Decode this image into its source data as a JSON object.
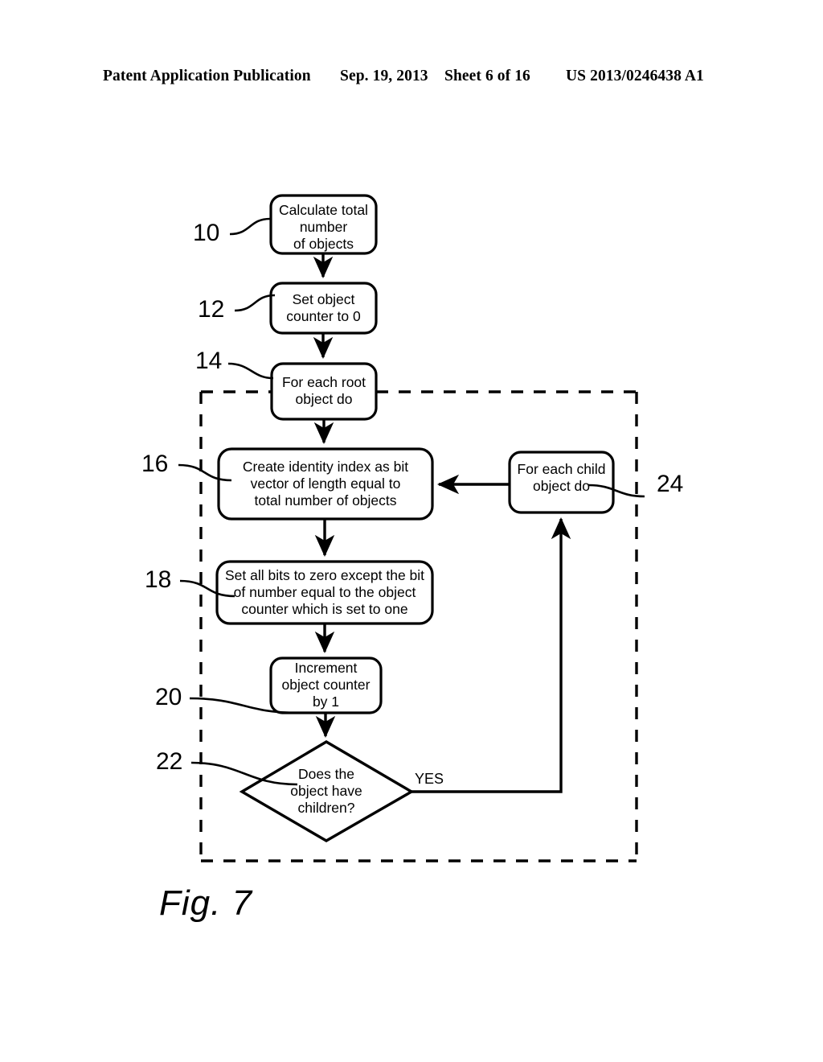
{
  "header": {
    "publication": "Patent Application Publication",
    "date": "Sep. 19, 2013",
    "sheet": "Sheet 6 of 16",
    "document_number": "US 2013/0246438 A1"
  },
  "figure": {
    "caption": "Fig. 7",
    "nodes": [
      {
        "id": "n10",
        "ref": "10",
        "shape": "rounded-rect",
        "text": "Calculate total\nnumber\nof objects"
      },
      {
        "id": "n12",
        "ref": "12",
        "shape": "rounded-rect",
        "text": "Set object\ncounter to 0"
      },
      {
        "id": "n14",
        "ref": "14",
        "shape": "rounded-rect",
        "text": "For each root\nobject do"
      },
      {
        "id": "n16",
        "ref": "16",
        "shape": "rounded-rect",
        "text": "Create identity index as bit\nvector of length equal to\ntotal number of objects"
      },
      {
        "id": "n18",
        "ref": "18",
        "shape": "rounded-rect",
        "text": "Set all bits to zero except the bit\nof number equal to the object\ncounter which is set to one"
      },
      {
        "id": "n20",
        "ref": "20",
        "shape": "rounded-rect",
        "text": "Increment\nobject counter\nby 1"
      },
      {
        "id": "n22",
        "ref": "22",
        "shape": "diamond",
        "text": "Does the\nobject have\nchildren?"
      },
      {
        "id": "n24",
        "ref": "24",
        "shape": "rounded-rect",
        "text": "For each child\nobject do"
      }
    ],
    "edge_labels": [
      {
        "id": "yes",
        "text": "YES"
      }
    ],
    "colors": {
      "stroke": "#000000",
      "fill": "#ffffff",
      "background": "#ffffff"
    }
  }
}
